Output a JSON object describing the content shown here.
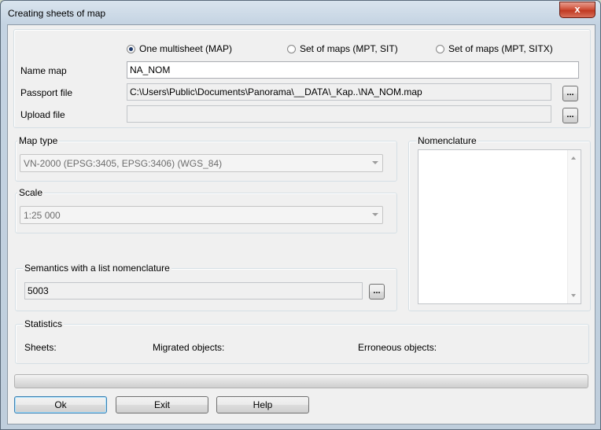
{
  "window": {
    "title": "Creating sheets of map",
    "close_glyph": "x"
  },
  "mode": {
    "options": [
      {
        "label": "One multisheet (MAP)",
        "selected": true
      },
      {
        "label": "Set of maps (MPT, SIT)",
        "selected": false
      },
      {
        "label": "Set of maps (MPT, SITX)",
        "selected": false
      }
    ]
  },
  "name_map": {
    "label": "Name map",
    "value": "NA_NOM"
  },
  "passport_file": {
    "label": "Passport file",
    "value": "C:\\Users\\Public\\Documents\\Panorama\\__DATA\\_Kap..\\NA_NOM.map",
    "button": "..."
  },
  "upload_file": {
    "label": "Upload file",
    "value": "",
    "button": "..."
  },
  "map_type": {
    "label": "Map type",
    "value": "VN-2000 (EPSG:3405, EPSG:3406) (WGS_84)"
  },
  "scale": {
    "label": "Scale",
    "value": "1:25 000"
  },
  "nomenclature": {
    "label": "Nomenclature",
    "items": []
  },
  "semantics": {
    "label": "Semantics with a list nomenclature",
    "value": "5003",
    "button": "..."
  },
  "statistics": {
    "label": "Statistics",
    "sheets": "Sheets:",
    "migrated": "Migrated objects:",
    "erroneous": "Erroneous objects:"
  },
  "buttons": {
    "ok": "Ok",
    "exit": "Exit",
    "help": "Help"
  }
}
